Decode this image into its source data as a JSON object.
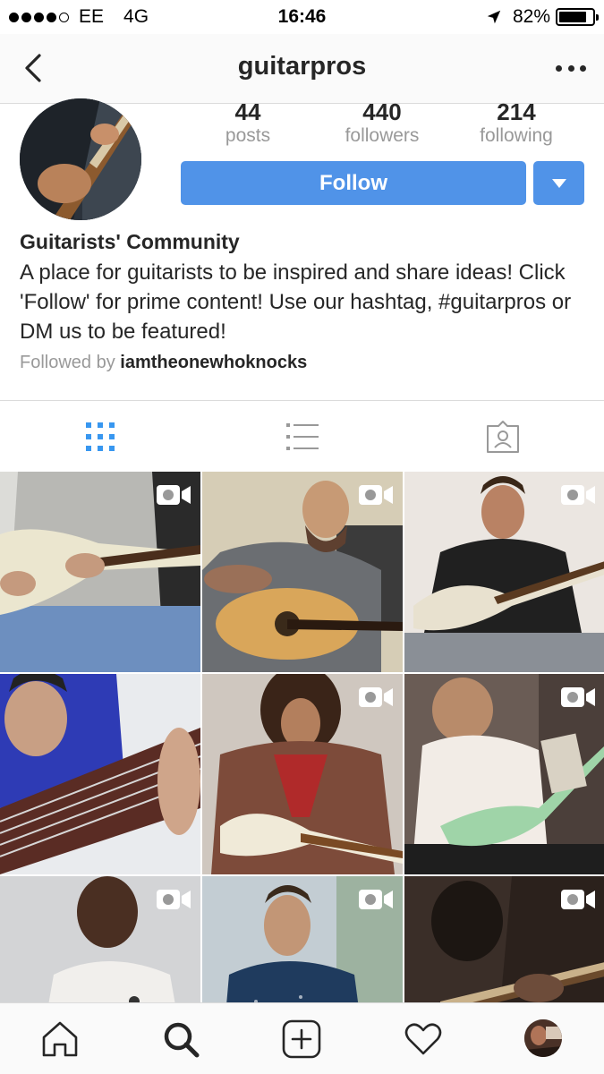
{
  "status_bar": {
    "carrier": "EE",
    "network": "4G",
    "time": "16:46",
    "battery": "82%",
    "battery_level": 0.82,
    "signal_bars_filled": 4,
    "signal_bars_total": 5
  },
  "nav": {
    "title": "guitarpros",
    "back_icon": "chevron-left-icon",
    "more_icon": "more-dots-icon"
  },
  "profile": {
    "stats": [
      {
        "number": "44",
        "label": "posts"
      },
      {
        "number": "440",
        "label": "followers"
      },
      {
        "number": "214",
        "label": "following"
      }
    ],
    "follow_label": "Follow",
    "dropdown_icon": "triangle-down-icon",
    "name": "Guitarists' Community",
    "bio": "A place for guitarists to be inspired and share ideas! Click 'Follow' for prime content! Use our hashtag, #guitarpros or DM us to be featured!",
    "followed_by_prefix": "Followed by",
    "followed_by_user": "iamtheonewhoknocks"
  },
  "view_tabs": [
    {
      "icon": "grid-icon",
      "active": true
    },
    {
      "icon": "list-icon",
      "active": false
    },
    {
      "icon": "tagged-photos-icon",
      "active": false
    }
  ],
  "posts": [
    {
      "video": true
    },
    {
      "video": true
    },
    {
      "video": true
    },
    {
      "video": false
    },
    {
      "video": true
    },
    {
      "video": true
    },
    {
      "video": true
    },
    {
      "video": true
    },
    {
      "video": true
    }
  ],
  "tab_bar": [
    "home-icon",
    "search-icon",
    "add-post-icon",
    "heart-icon",
    "profile-avatar"
  ],
  "colors": {
    "accent_blue": "#5093e8",
    "muted_text": "#999999",
    "divider": "#dbdbdb"
  }
}
